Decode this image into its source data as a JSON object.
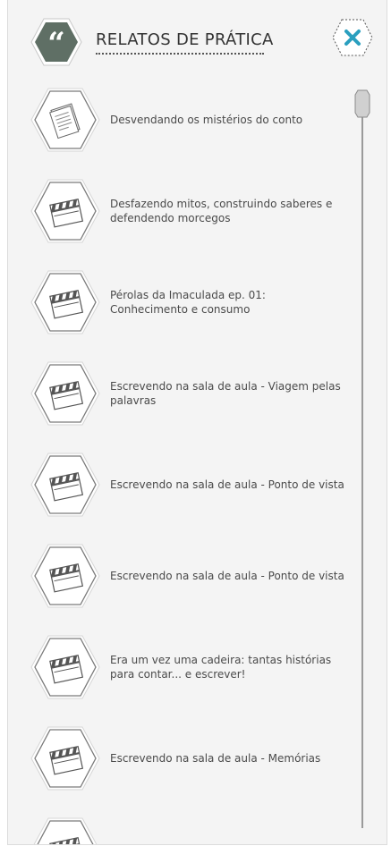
{
  "header": {
    "title": "RELATOS DE PRÁTICA",
    "badge_icon": "quote-icon",
    "close_icon": "close-icon",
    "accent_color": "#5f6f65",
    "close_color": "#2a9fbf"
  },
  "items": [
    {
      "label": "Desvendando os mistérios do conto",
      "icon": "document-icon"
    },
    {
      "label": "Desfazendo mitos, construindo saberes e defendendo morcegos",
      "icon": "clapperboard-icon"
    },
    {
      "label": "Pérolas da Imaculada ep. 01: Conhecimento e consumo",
      "icon": "clapperboard-icon"
    },
    {
      "label": "Escrevendo na sala de aula - Viagem pelas palavras",
      "icon": "clapperboard-icon"
    },
    {
      "label": "Escrevendo na sala de aula - Ponto de vista",
      "icon": "clapperboard-icon"
    },
    {
      "label": "Escrevendo na sala de aula - Ponto de vista",
      "icon": "clapperboard-icon"
    },
    {
      "label": "Era um vez uma cadeira: tantas histórias para contar... e escrever!",
      "icon": "clapperboard-icon"
    },
    {
      "label": "Escrevendo na sala de aula - Memórias",
      "icon": "clapperboard-icon"
    },
    {
      "label": "",
      "icon": "clapperboard-icon"
    }
  ]
}
